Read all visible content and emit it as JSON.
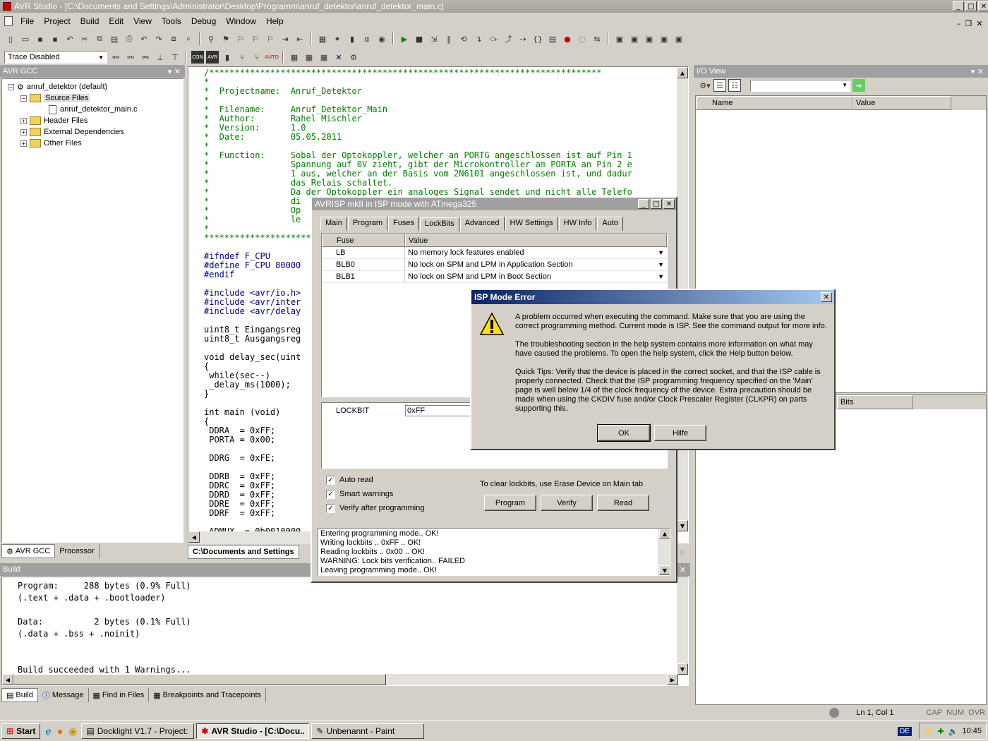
{
  "window": {
    "title": "AVR Studio - [C:\\Documents and Settings\\Administrator\\Desktop\\Programm\\anruf_detektor\\anruf_detektor_main.c]"
  },
  "menu": [
    "File",
    "Project",
    "Build",
    "Edit",
    "View",
    "Tools",
    "Debug",
    "Window",
    "Help"
  ],
  "trace": {
    "value": "Trace Disabled"
  },
  "left_panel": {
    "title": "AVR GCC",
    "tree": {
      "root": "anruf_detektor (default)",
      "source_files": "Source Files",
      "main_file": "anruf_detektor_main.c",
      "header_files": "Header Files",
      "external": "External Dependencies",
      "other": "Other Files"
    },
    "tabs": [
      "AVR GCC",
      "Processor"
    ]
  },
  "editor": {
    "lines": [
      "/*****************************************************************************",
      "*",
      "*  Projectname:  Anruf_Detektor",
      "*",
      "*  Filename:     Anruf_Detektor_Main",
      "*  Author:       Rahel Mischler",
      "*  Version:      1.0",
      "*  Date:         05.05.2011",
      "*",
      "*  Function:     Sobal der Optokoppler, welcher an PORTG angeschlossen ist auf Pin 1",
      "*                Spannung auf 0V zieht, gibt der Microkontroller am PORTA an Pin 2 e",
      "*                1 aus, welcher an der Basis vom 2N6101 angeschlossen ist, und dadur",
      "*                das Relais schaltet.",
      "*                Da der Optokoppler ein analoges Signal sendet und nicht alle Telefo",
      "*                di",
      "*                Op",
      "*                le",
      "*",
      "*****************************************************************************",
      "",
      "#ifndef F_CPU",
      "#define F_CPU 80000",
      "#endif",
      "",
      "#include <avr/io.h>",
      "#include <avr/inter",
      "#include <avr/delay",
      "",
      "uint8_t Eingangsreg",
      "uint8_t Ausgangsreg",
      "",
      "void delay_sec(uint",
      "{",
      " while(sec--)",
      " _delay_ms(1000);",
      "}",
      "",
      "int main (void)",
      "{",
      " DDRA  = 0xFF;",
      " PORTA = 0x00;",
      "",
      " DDRG  = 0xFE;",
      "",
      " DDRB  = 0xFF;",
      " DDRC  = 0xFF;",
      " DDRD  = 0xFF;",
      " DDRE  = 0xFF;",
      " DDRF  = 0xFF;",
      "",
      " ADMUX  = 0b0010000"
    ],
    "tab_label": "C:\\Documents and Settings"
  },
  "io_view": {
    "title": "I/O View",
    "columns": [
      "Name",
      "Value"
    ],
    "bits_col": "Bits"
  },
  "build": {
    "title": "Build",
    "lines": [
      "Program:     288 bytes (0.9% Full)",
      "(.text + .data + .bootloader)",
      "",
      "Data:          2 bytes (0.1% Full)",
      "(.data + .bss + .noinit)",
      "",
      "",
      "Build succeeded with 1 Warnings..."
    ],
    "tabs": [
      "Build",
      "Message",
      "Find in Files",
      "Breakpoints and Tracepoints"
    ]
  },
  "avrisp": {
    "title": "AVRISP mkII in ISP mode with ATmega325",
    "tabs": [
      "Main",
      "Program",
      "Fuses",
      "LockBits",
      "Advanced",
      "HW Settings",
      "HW Info",
      "Auto"
    ],
    "columns": [
      "Fuse",
      "Value"
    ],
    "rows": [
      {
        "fuse": "LB",
        "value": "No memory lock features enabled"
      },
      {
        "fuse": "BLB0",
        "value": "No lock on SPM and LPM in Application Section"
      },
      {
        "fuse": "BLB1",
        "value": "No lock on SPM and LPM in Boot Section"
      }
    ],
    "lockbit_label": "LOCKBIT",
    "lockbit_value": "0xFF",
    "auto_read": "Auto read",
    "smart_warnings": "Smart warnings",
    "verify_after": "Verify after programming",
    "clear_note": "To clear lockbits, use Erase Device on Main tab",
    "buttons": [
      "Program",
      "Verify",
      "Read"
    ],
    "log": [
      "Entering programming mode.. OK!",
      "Writing lockbits .. 0xFF .. OK!",
      "Reading lockbits .. 0x00 .. OK!",
      "WARNING: Lock bits verification..  FAILED",
      "Leaving programming mode.. OK!"
    ]
  },
  "error": {
    "title": "ISP Mode Error",
    "p1": "A problem occurred when executing the command. Make sure that you are using the correct programming method. Current mode is ISP. See the command output for more info.",
    "p2": "The troubleshooting section in the help system contains more information on what may have caused the problems. To open the help system, click the Help button below.",
    "p3": "Quick Tips: Verify that the device is placed in the correct socket, and that the ISP cable is properly connected. Check that the ISP programming frequency specified on the 'Main' page is well below 1/4 of the clock frequency of the device. Extra precaution should be made when using the CKDIV fuse and/or Clock Prescaler Register (CLKPR) on parts supporting this.",
    "ok": "OK",
    "help": "Hilfe"
  },
  "status": {
    "pos": "Ln 1, Col 1",
    "cap": "CAP",
    "num": "NUM",
    "ovr": "OVR"
  },
  "taskbar": {
    "start": "Start",
    "tasks": [
      "Docklight V1.7 - Project: ...",
      "AVR Studio - [C:\\Docu...",
      "Unbenannt - Paint"
    ],
    "lang": "DE",
    "clock": "10:45"
  }
}
